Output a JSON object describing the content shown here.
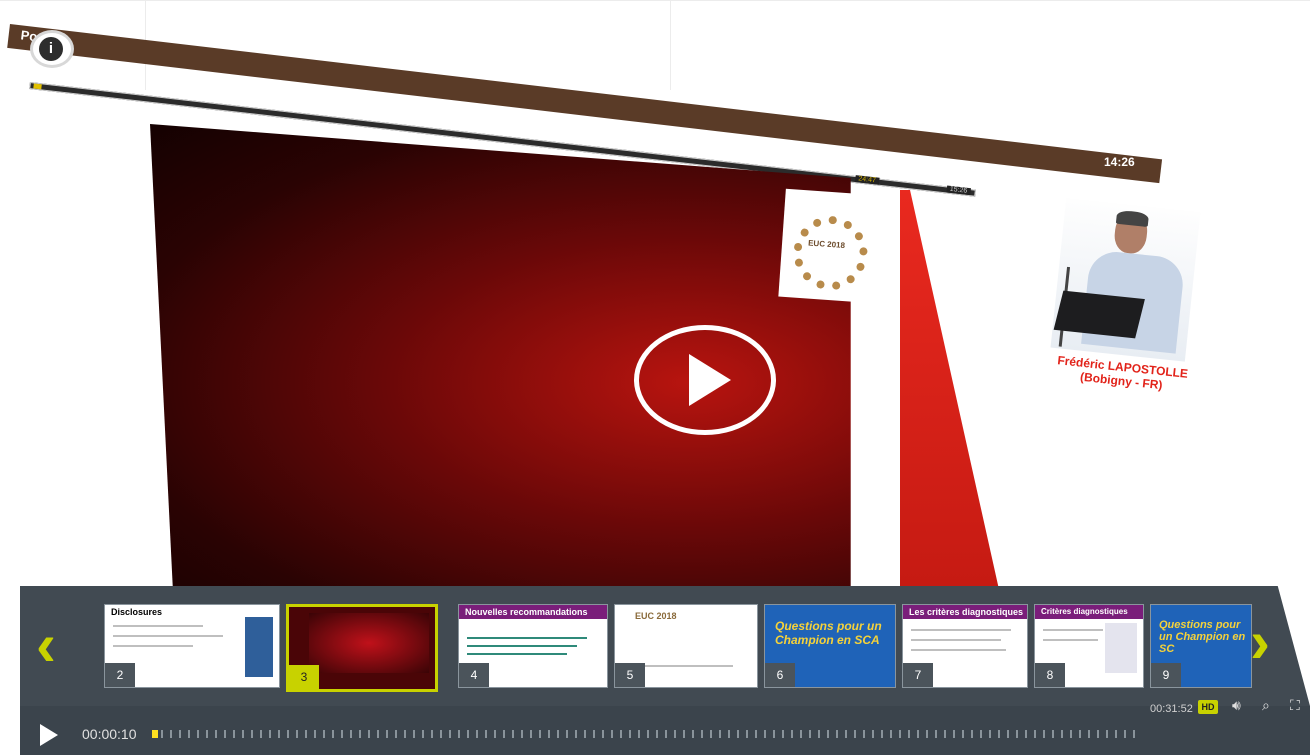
{
  "header": {
    "title": "Podium"
  },
  "info_button": {
    "label": "i"
  },
  "top_timeline": {
    "current": "24:47",
    "end": "15:26"
  },
  "clock": "14:26",
  "logo_text": "EUC 2018",
  "speaker": {
    "name": "Frédéric LAPOSTOLLE",
    "affiliation": "(Bobigny - FR)"
  },
  "slides": [
    {
      "number": "2",
      "title": "Disclosures"
    },
    {
      "number": "3",
      "title": ""
    },
    {
      "number": "4",
      "title": "Nouvelles recommandations"
    },
    {
      "number": "5",
      "title": "EUC 2018"
    },
    {
      "number": "6",
      "title": "Questions pour un Champion en SCA"
    },
    {
      "number": "7",
      "title": "Les critères diagnostiques"
    },
    {
      "number": "8",
      "title": "Critères diagnostiques"
    },
    {
      "number": "9",
      "title": "Questions pour un Champion en SC"
    }
  ],
  "controls": {
    "current_time": "00:00:10",
    "duration": "00:31:52",
    "hd_label": "HD",
    "progress": 0.005
  },
  "colors": {
    "accent": "#c8d200",
    "header": "#5a3b27",
    "speaker_name": "#e2231a"
  }
}
